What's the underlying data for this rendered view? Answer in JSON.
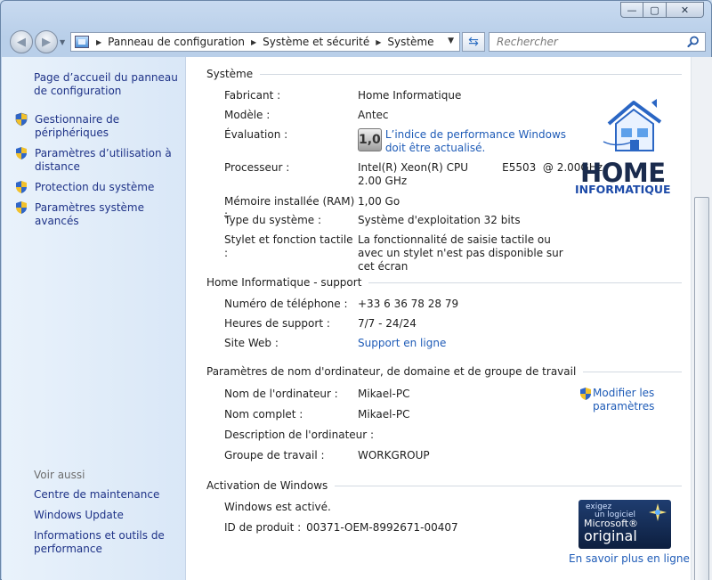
{
  "window": {
    "minimize_glyph": "—",
    "maximize_glyph": "▢",
    "close_glyph": "✕"
  },
  "navbar": {
    "breadcrumbs": [
      "Panneau de configuration",
      "Système et sécurité",
      "Système"
    ],
    "search_placeholder": "Rechercher"
  },
  "sidebar": {
    "home_link": "Page d’accueil du panneau de configuration",
    "items": [
      {
        "label": "Gestionnaire de périphériques",
        "icon": "uac-shield-icon"
      },
      {
        "label": "Paramètres d’utilisation à distance",
        "icon": "uac-shield-icon"
      },
      {
        "label": "Protection du système",
        "icon": "uac-shield-icon"
      },
      {
        "label": "Paramètres système avancés",
        "icon": "uac-shield-icon"
      }
    ],
    "see_also_heading": "Voir aussi",
    "see_also": [
      "Centre de maintenance",
      "Windows Update",
      "Informations et outils de performance"
    ]
  },
  "system": {
    "heading": "Système",
    "manufacturer_label": "Fabricant :",
    "manufacturer": "Home Informatique",
    "model_label": "Modèle :",
    "model": "Antec",
    "rating_label": "Évaluation :",
    "rating_badge": "1,0",
    "rating_link": "L’indice de performance Windows doit être actualisé.",
    "processor_label": "Processeur :",
    "processor_line1": "Intel(R) Xeon(R) CPU          E5503  @ 2.00GHz",
    "processor_line2": "2.00 GHz",
    "ram_label": "Mémoire installée (RAM) :",
    "ram": "1,00 Go",
    "type_label": "Type du système :",
    "type": "Système d'exploitation 32 bits",
    "pen_label": "Stylet et fonction tactile :",
    "pen": "La fonctionnalité de saisie tactile ou avec un stylet n'est pas disponible sur cet écran",
    "logo_line1": "HOME",
    "logo_line2": "INFORMATIQUE"
  },
  "support": {
    "heading": "Home Informatique - support",
    "phone_label": "Numéro de téléphone :",
    "phone": "+33 6 36 78 28 79",
    "hours_label": "Heures de support :",
    "hours": "7/7 - 24/24",
    "web_label": "Site Web :",
    "web": "Support en ligne"
  },
  "computer": {
    "heading": "Paramètres de nom d'ordinateur, de domaine et de groupe de travail",
    "name_label": "Nom de l'ordinateur :",
    "name": "Mikael-PC",
    "full_label": "Nom complet :",
    "full": "Mikael-PC",
    "desc_label": "Description de l'ordinateur :",
    "desc": "",
    "group_label": "Groupe de travail :",
    "group": "WORKGROUP",
    "modify_link": "Modifier les paramètres"
  },
  "activation": {
    "heading": "Activation de Windows",
    "status": "Windows est activé.",
    "product_id_label": "ID de produit :",
    "product_id": "00371-OEM-8992671-00407",
    "genuine_line1": "exigez",
    "genuine_line2": "un logiciel",
    "genuine_line3": "Microsoft®",
    "genuine_line4": "original",
    "learn_more": "En savoir plus en ligne..."
  },
  "colors": {
    "link": "#1e5bb7",
    "nav_link": "#1e3287",
    "sidebar_bg": "#dfeaf7",
    "content_bg": "#ffffff"
  }
}
